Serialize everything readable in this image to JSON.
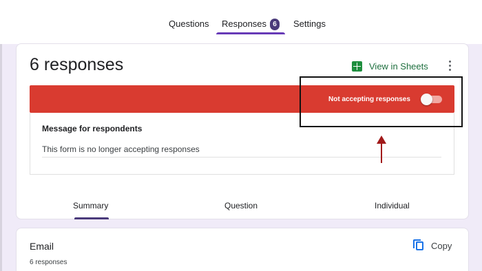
{
  "tabs": {
    "questions": "Questions",
    "responses": "Responses",
    "responses_count": "6",
    "settings": "Settings"
  },
  "summary_card": {
    "title": "6 responses",
    "sheets_label": "View in Sheets",
    "banner_label": "Not accepting responses",
    "toggle_on": false,
    "message_heading": "Message for respondents",
    "message_text": "This form is no longer accepting responses"
  },
  "subtabs": {
    "summary": "Summary",
    "question": "Question",
    "individual": "Individual"
  },
  "email_card": {
    "title": "Email",
    "count": "6 responses",
    "copy_label": "Copy"
  },
  "colors": {
    "banner": "#d93b30",
    "accent": "#673ab7",
    "sheets_green": "#1e8e3e",
    "annotation_arrow": "#a11a1a",
    "background": "#f0ebf8"
  },
  "icons": {
    "sheets": "google-sheets-icon",
    "menu": "more-vert-icon",
    "copy": "copy-icon",
    "annotation": "arrow-up-icon"
  }
}
